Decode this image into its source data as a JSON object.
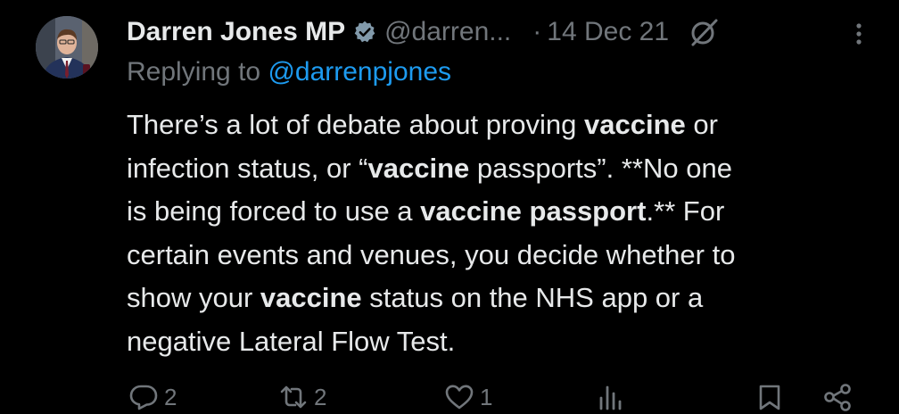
{
  "tweet": {
    "display_name": "Darren Jones MP",
    "handle": "@darren...",
    "separator": "·",
    "date": "14 Dec 21",
    "replying_prefix": "Replying to",
    "replying_to": "@darrenpjones",
    "body": {
      "line1": {
        "a": "There’s a lot of debate about proving ",
        "b": "vaccine",
        "c": " or"
      },
      "line2": {
        "a": "infection status, or “",
        "b": "vaccine",
        "c": " passports”. **No one"
      },
      "line3": {
        "a": "is being forced to use a ",
        "b": "vaccine passport",
        "c": ".** For"
      },
      "line4": {
        "a": "certain events and venues, you decide whether to"
      },
      "line5": {
        "a": "show your ",
        "b": "vaccine",
        "c": " status on the NHS app or a"
      },
      "line6": {
        "a": "negative Lateral Flow Test."
      }
    },
    "actions": {
      "reply_count": "2",
      "retweet_count": "2",
      "like_count": "1"
    }
  },
  "colors": {
    "background": "#000000",
    "text": "#e7e9ea",
    "secondary": "#71767b",
    "link": "#1d9bf0"
  },
  "icons": {
    "verified": "verified-badge-icon",
    "grok": "grok-icon",
    "more": "more-options-icon",
    "reply": "reply-icon",
    "retweet": "retweet-icon",
    "like": "like-icon",
    "views": "views-icon",
    "bookmark": "bookmark-icon",
    "share": "share-icon"
  }
}
